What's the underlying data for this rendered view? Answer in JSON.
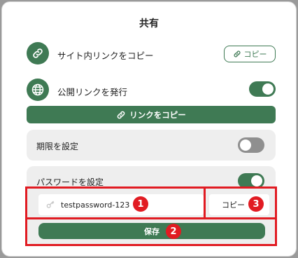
{
  "dialog": {
    "title": "共有"
  },
  "site_link": {
    "label": "サイト内リンクをコピー",
    "copy_button": "コピー",
    "icon": "link-icon"
  },
  "public_link": {
    "label": "公開リンクを発行",
    "enabled": true,
    "icon": "globe-icon",
    "copy_link_button": "リンクをコピー"
  },
  "expiry": {
    "label": "期限を設定",
    "enabled": false
  },
  "password": {
    "label": "パスワードを設定",
    "enabled": true,
    "value": "testpassword-123",
    "copy_button": "コピー",
    "save_button": "保存"
  },
  "annotations": {
    "badge_1": "1",
    "badge_2": "2",
    "badge_3": "3"
  },
  "colors": {
    "accent": "#3f7a54",
    "highlight": "#e11b22",
    "toggle_off": "#8f8f8f",
    "panel_bg": "#eeeeee"
  }
}
